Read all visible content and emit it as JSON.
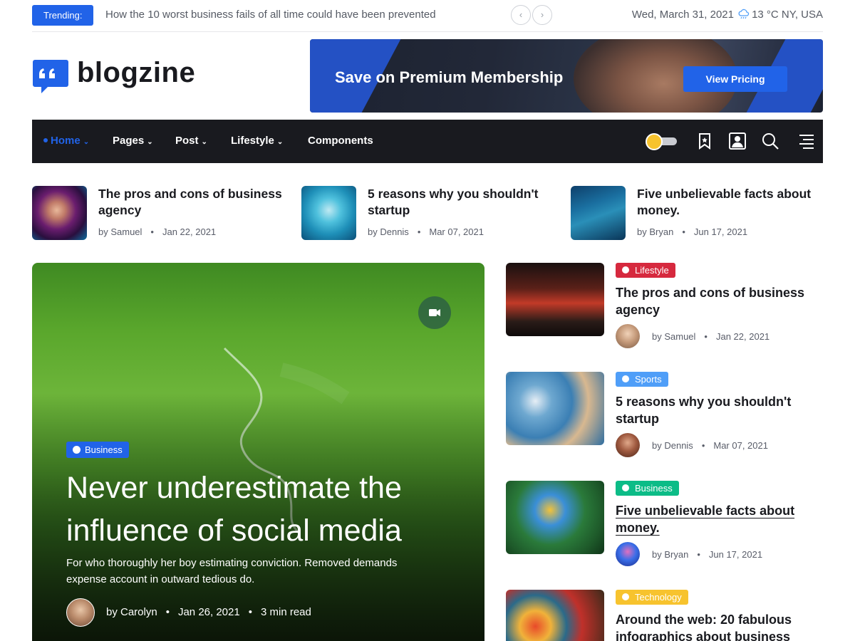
{
  "topbar": {
    "trending_label": "Trending:",
    "trending_text": "How the 10 worst business fails of all time could have been prevented",
    "prev_icon": "chevron-left-icon",
    "next_icon": "chevron-right-icon",
    "date": "Wed, March 31, 2021",
    "weather": "13 °C NY, USA"
  },
  "logo": {
    "text": "blogzine"
  },
  "banner": {
    "title": "Save on Premium Membership",
    "button": "View Pricing"
  },
  "nav": {
    "items": [
      {
        "label": "Home"
      },
      {
        "label": "Pages"
      },
      {
        "label": "Post"
      },
      {
        "label": "Lifestyle"
      },
      {
        "label": "Components"
      }
    ],
    "chevron": "⌄"
  },
  "mini_posts": [
    {
      "title": "The pros and cons of business agency",
      "author": "by Samuel",
      "date": "Jan 22, 2021"
    },
    {
      "title": "5 reasons why you shouldn't startup",
      "author": "by Dennis",
      "date": "Mar 07, 2021"
    },
    {
      "title": "Five unbelievable facts about money.",
      "author": "by Bryan",
      "date": "Jun 17, 2021"
    }
  ],
  "hero": {
    "category": "Business",
    "title": "Never underestimate the influence of social media",
    "description": "For who thoroughly her boy estimating conviction. Removed demands expense account in outward tedious do.",
    "author": "by Carolyn",
    "date": "Jan 26, 2021",
    "read_time": "3 min read"
  },
  "posts": [
    {
      "category": "Lifestyle",
      "category_color": "#d6293e",
      "title": "The pros and cons of business agency",
      "author": "by Samuel",
      "date": "Jan 22, 2021"
    },
    {
      "category": "Sports",
      "category_color": "#4f9ef8",
      "title": "5 reasons why you shouldn't startup",
      "author": "by Dennis",
      "date": "Mar 07, 2021"
    },
    {
      "category": "Business",
      "category_color": "#0cbc87",
      "title": "Five unbelievable facts about money.",
      "author": "by Bryan",
      "date": "Jun 17, 2021"
    },
    {
      "category": "Technology",
      "category_color": "#f7c32e",
      "title": "Around the web: 20 fabulous infographics about business",
      "author": "",
      "date": ""
    }
  ],
  "separator": "•"
}
